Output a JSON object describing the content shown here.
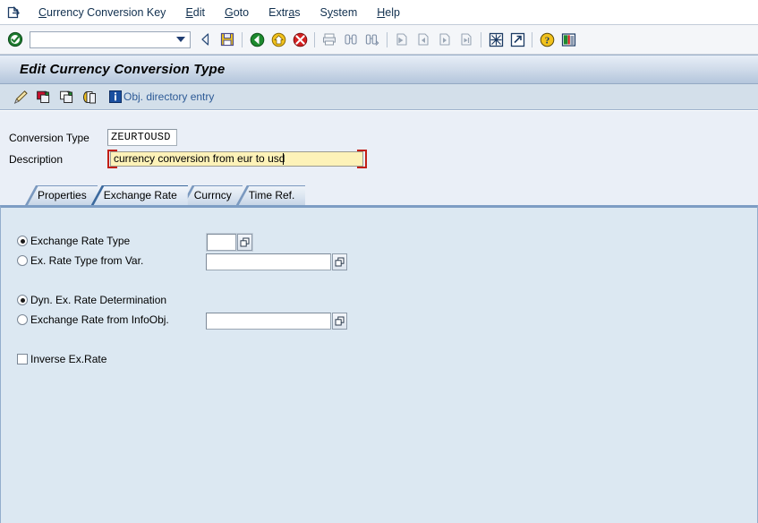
{
  "window": {
    "system_icon": "sap-session-icon"
  },
  "menubar": {
    "items": [
      {
        "label": "Currency Conversion Key",
        "accel": "C"
      },
      {
        "label": "Edit",
        "accel": "E"
      },
      {
        "label": "Goto",
        "accel": "G"
      },
      {
        "label": "Extras",
        "accel": "a"
      },
      {
        "label": "System",
        "accel": "y"
      },
      {
        "label": "Help",
        "accel": "H"
      }
    ]
  },
  "toolbar": {
    "enter_icon": "green-check-enter-icon",
    "command_field": {
      "value": "",
      "placeholder": "",
      "dropdown_icon": "chevron-down-icon"
    },
    "buttons": [
      {
        "name": "back-icon",
        "enabled": true
      },
      {
        "name": "save-icon",
        "enabled": true
      },
      {
        "name": "exit-icon",
        "enabled": true
      },
      {
        "name": "cancel-icon",
        "enabled": true
      },
      {
        "name": "stop-icon",
        "enabled": true
      },
      {
        "name": "print-icon",
        "enabled": false
      },
      {
        "name": "find-icon",
        "enabled": false
      },
      {
        "name": "find-next-icon",
        "enabled": false
      },
      {
        "name": "first-page-icon",
        "enabled": false
      },
      {
        "name": "previous-page-icon",
        "enabled": false
      },
      {
        "name": "next-page-icon",
        "enabled": false
      },
      {
        "name": "last-page-icon",
        "enabled": false
      },
      {
        "name": "create-session-icon",
        "enabled": true
      },
      {
        "name": "create-shortcut-icon",
        "enabled": true
      },
      {
        "name": "help-icon",
        "enabled": true
      },
      {
        "name": "customize-layout-icon",
        "enabled": true
      }
    ]
  },
  "title": {
    "text": "Edit Currency Conversion Type"
  },
  "app_toolbar": {
    "buttons": [
      {
        "name": "display-change-pencil-icon"
      },
      {
        "name": "copy-object-icon"
      },
      {
        "name": "delete-object-icon"
      },
      {
        "name": "duplicate-icon"
      }
    ],
    "obj_directory": {
      "icon": "info-icon",
      "label": "Obj. directory entry"
    }
  },
  "form": {
    "conversion_type": {
      "label": "Conversion Type",
      "value": "ZEURTOUSD"
    },
    "description": {
      "label": "Description",
      "value": "currency conversion from eur to usd",
      "focused": true
    }
  },
  "tabs": {
    "items": [
      {
        "label": "Properties",
        "active": false
      },
      {
        "label": "Exchange Rate",
        "active": true
      },
      {
        "label": "Currncy",
        "active": false
      },
      {
        "label": "Time Ref.",
        "active": false
      }
    ]
  },
  "exchange_rate_panel": {
    "group1": {
      "option_exchange_rate_type": {
        "label": "Exchange Rate Type",
        "selected": true,
        "input_value": "",
        "matchcode_icon": "matchcode-icon"
      },
      "option_ex_rate_type_from_var": {
        "label": "Ex. Rate Type from Var.",
        "selected": false,
        "input_value": "",
        "matchcode_icon": "matchcode-icon"
      }
    },
    "group2": {
      "option_dyn_ex_rate_determination": {
        "label": "Dyn. Ex. Rate Determination",
        "selected": true
      },
      "option_exchange_rate_from_infoobj": {
        "label": "Exchange Rate from InfoObj.",
        "selected": false,
        "input_value": "",
        "matchcode_icon": "matchcode-icon"
      }
    },
    "inverse": {
      "label": "Inverse Ex.Rate",
      "checked": false
    }
  },
  "colors": {
    "focus_bracket": "#c21f16",
    "focused_field_bg": "#fdf2b8",
    "title_gradient_top": "#e7eef7",
    "title_gradient_bottom": "#b4c6dc",
    "tab_panel_bg": "#dce8f2",
    "canvas_bg": "#eaeff7",
    "link_text": "#2d5a96"
  }
}
